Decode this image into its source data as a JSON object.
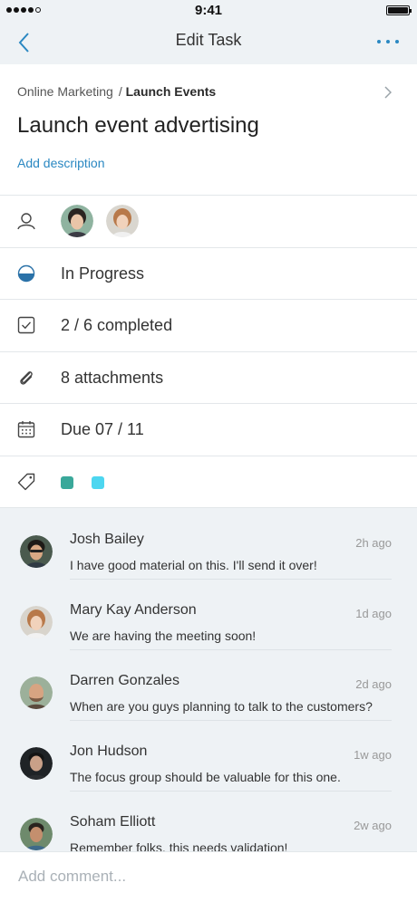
{
  "status_bar": {
    "time": "9:41"
  },
  "nav": {
    "title": "Edit Task"
  },
  "breadcrumb": {
    "parent": "Online Marketing",
    "separator": "/",
    "current": "Launch Events"
  },
  "task": {
    "title": "Launch event advertising",
    "add_description_label": "Add description"
  },
  "details": {
    "status": "In Progress",
    "checklist": "2 / 6 completed",
    "attachments": "8 attachments",
    "due": "Due 07 / 11",
    "tag_colors": [
      "#3aa89a",
      "#4dd6f0"
    ]
  },
  "comments": [
    {
      "author": "Josh Bailey",
      "time": "2h ago",
      "text": "I have good material on this. I'll send it over!"
    },
    {
      "author": "Mary Kay Anderson",
      "time": "1d ago",
      "text": "We are having the meeting soon!"
    },
    {
      "author": "Darren Gonzales",
      "time": "2d ago",
      "text": "When are you guys planning to talk to the customers?"
    },
    {
      "author": "Jon Hudson",
      "time": "1w ago",
      "text": "The focus group should be valuable for this one."
    },
    {
      "author": "Soham Elliott",
      "time": "2w ago",
      "text": "Remember folks, this needs validation!"
    }
  ],
  "composer": {
    "placeholder": "Add comment..."
  },
  "colors": {
    "accent": "#2b88c2",
    "panel_bg": "#eef2f5"
  }
}
